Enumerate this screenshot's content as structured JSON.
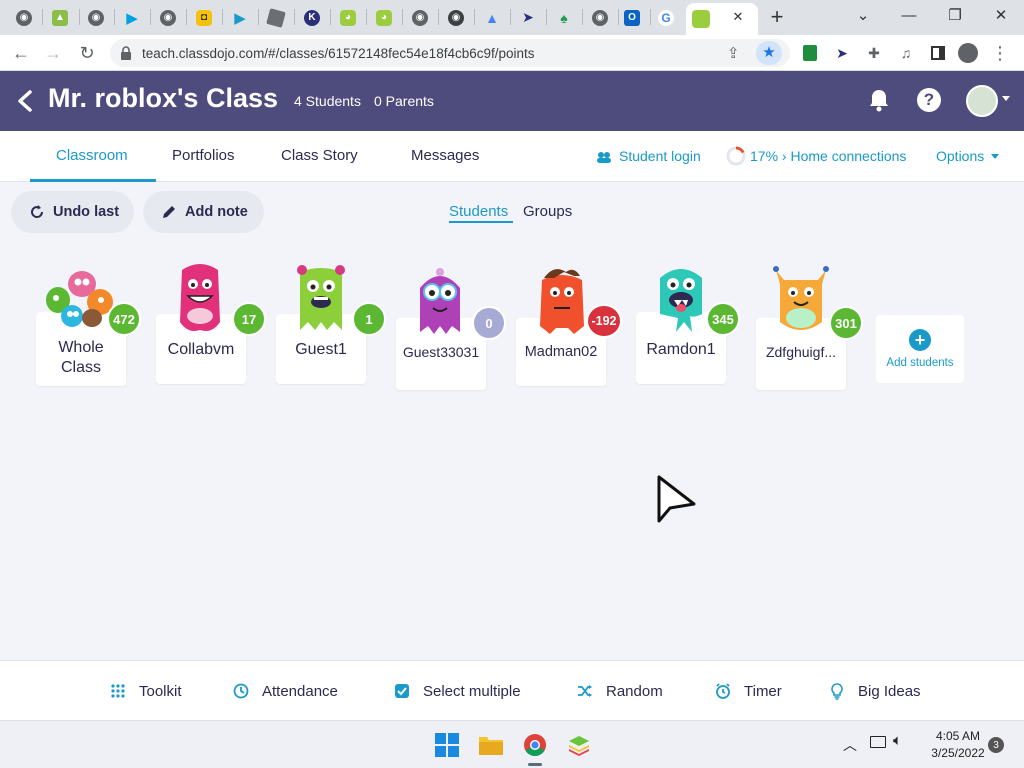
{
  "browser": {
    "url": "teach.classdojo.com/#/classes/61572148fec54e18f4cb6c9f/points",
    "tab_icons": [
      "chrome-icon",
      "android-icon",
      "chrome-icon",
      "play-icon",
      "chrome-icon",
      "app-icon",
      "play-icon",
      "roblox-icon",
      "k-icon",
      "monster-icon",
      "monster-icon",
      "chrome-icon",
      "chrome-icon",
      "drive-icon",
      "cursor-icon",
      "leaf-icon",
      "chrome-icon",
      "outlook-icon",
      "google-icon",
      "monster-icon"
    ],
    "close_tab_label": "✕",
    "new_tab_label": "+"
  },
  "header": {
    "title": "Mr. roblox's Class",
    "students": "4 Students",
    "parents": "0 Parents"
  },
  "nav": {
    "tabs": [
      "Classroom",
      "Portfolios",
      "Class Story",
      "Messages"
    ],
    "student_login": "Student login",
    "home_connections": "17% › Home connections",
    "options": "Options"
  },
  "toolbar": {
    "undo": "Undo last",
    "add_note": "Add note",
    "view_students": "Students",
    "view_groups": "Groups"
  },
  "students": [
    {
      "name": "Whole\nClass",
      "score": "472",
      "color": "#5cb832"
    },
    {
      "name": "Collabvm",
      "score": "17",
      "color": "#5cb832"
    },
    {
      "name": "Guest1",
      "score": "1",
      "color": "#5cb832"
    },
    {
      "name": "Guest33031",
      "score": "0",
      "color": "#a8aad6"
    },
    {
      "name": "Madman02",
      "score": "-192",
      "color": "#d8323c"
    },
    {
      "name": "Ramdon1",
      "score": "345",
      "color": "#5cb832"
    },
    {
      "name": "Zdfghuigf...",
      "score": "301",
      "color": "#5cb832"
    }
  ],
  "add_students": "Add students",
  "toolkit": {
    "items": [
      "Toolkit",
      "Attendance",
      "Select multiple",
      "Random",
      "Timer",
      "Big Ideas"
    ]
  },
  "taskbar": {
    "time": "4:05 AM",
    "date": "3/25/2022",
    "notifications": "3"
  },
  "colors": {
    "header_bg": "#4e4c7d",
    "accent": "#1a9ac8",
    "score_positive": "#5cb832",
    "score_negative": "#d8323c",
    "score_zero": "#a8aad6"
  }
}
